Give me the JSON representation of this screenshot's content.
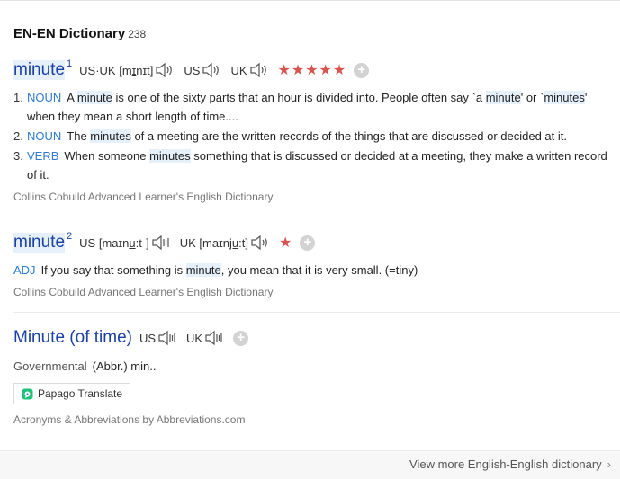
{
  "header": {
    "title": "EN-EN Dictionary",
    "count": "238"
  },
  "entries": [
    {
      "headword": "minute",
      "sup": "1",
      "pron_usuk_label": "US·UK [m",
      "pron_usuk_ul": "ɪ",
      "pron_usuk_tail": "nɪt]",
      "us_label": "US",
      "uk_label": "UK",
      "stars": "★★★★★",
      "plus": "+",
      "senses": [
        {
          "num": "1.",
          "pos": "NOUN",
          "t1": "A ",
          "k1": "minute",
          "t2": " is one of the sixty parts that an hour is divided into. People often say `a ",
          "k2": "minute",
          "t3": "' or `",
          "k3": "minutes",
          "t4": "' when they mean a short length of time...."
        },
        {
          "num": "2.",
          "pos": "NOUN",
          "t1": "The ",
          "k1": "minutes",
          "t2": " of a meeting are the written records of the things that are discussed or decided at it."
        },
        {
          "num": "3.",
          "pos": "VERB",
          "t1": "When someone ",
          "k1": "minutes",
          "t2": " something that is discussed or decided at a meeting, they make a written record of it."
        }
      ],
      "source": "Collins Cobuild Advanced Learner's English Dictionary"
    },
    {
      "headword": "minute",
      "sup": "2",
      "us_pron_a": "US [maɪn",
      "us_pron_ul": "u",
      "us_pron_b": ":t-]",
      "uk_pron_a": "UK [maɪn",
      "uk_pron_ul": "ju",
      "uk_pron_b": ":t]",
      "stars": "★",
      "plus": "+",
      "pos": "ADJ",
      "t1": "If you say that something is ",
      "k1": "minute",
      "t2": ", you mean that it is very small. (=tiny)",
      "source": "Collins Cobuild Advanced Learner's English Dictionary"
    },
    {
      "headword": "Minute (of time)",
      "us_label": "US",
      "uk_label": "UK",
      "plus": "+",
      "category": "Governmental",
      "abbr": "(Abbr.) min..",
      "papago": "Papago Translate",
      "source": "Acronyms & Abbreviations by Abbreviations.com"
    }
  ],
  "footer": {
    "more": "View more English-English dictionary",
    "chevron": "›"
  },
  "colors": {
    "headword": "#1b40a3",
    "pos": "#2e7bcf",
    "stars": "#d9534f",
    "highlight": "#e6f0fb"
  }
}
